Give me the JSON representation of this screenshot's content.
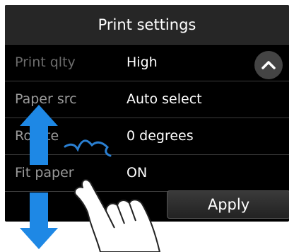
{
  "header": {
    "title": "Print settings"
  },
  "settings": [
    {
      "label": "Print qlty",
      "value": "High"
    },
    {
      "label": "Paper src",
      "value": "Auto select"
    },
    {
      "label": "Rotate",
      "value": "0 degrees"
    },
    {
      "label": "Fit paper",
      "value": "ON"
    }
  ],
  "apply_label": "Apply",
  "colors": {
    "screen_bg": "#000000",
    "header_bg": "#262626",
    "label_text": "#9a9a9a",
    "value_text": "#ffffff",
    "gesture_arrow": "#1e88e5"
  },
  "icons": {
    "scroll_up": "chevron-up-icon",
    "gesture": "swipe-hand-icon"
  }
}
